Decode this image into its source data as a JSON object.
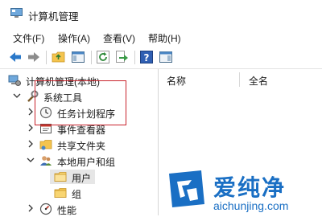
{
  "window": {
    "title": "计算机管理"
  },
  "menubar": {
    "items": [
      {
        "label": "文件(F)"
      },
      {
        "label": "操作(A)"
      },
      {
        "label": "查看(V)"
      },
      {
        "label": "帮助(H)"
      }
    ]
  },
  "toolbar": {
    "buttons": [
      "back-icon",
      "forward-icon",
      "up-folder-icon",
      "show-hide-tree-icon",
      "refresh-icon",
      "export-icon",
      "help-icon",
      "properties-icon"
    ]
  },
  "tree": {
    "root": {
      "label": "计算机管理(本地)",
      "icon": "computer-management-icon"
    },
    "system_tools": {
      "label": "系统工具",
      "icon": "tools-icon"
    },
    "task_scheduler": {
      "label": "任务计划程序",
      "icon": "clock-icon"
    },
    "event_viewer": {
      "label": "事件查看器",
      "icon": "event-viewer-icon"
    },
    "shared_folders": {
      "label": "共享文件夹",
      "icon": "shared-folder-icon"
    },
    "local_users": {
      "label": "本地用户和组",
      "icon": "users-icon"
    },
    "users": {
      "label": "用户",
      "icon": "folder-icon",
      "selected": true
    },
    "groups": {
      "label": "组",
      "icon": "folder-icon"
    },
    "performance": {
      "label": "性能",
      "icon": "performance-icon"
    }
  },
  "list": {
    "columns": [
      {
        "label": "名称"
      },
      {
        "label": "全名"
      }
    ]
  },
  "watermark": {
    "big": "爱纯净",
    "small": "aichunjing.com"
  },
  "colors": {
    "highlight": "#c8232c",
    "folder": "#f4c44e",
    "accent": "#1a6fc4"
  }
}
